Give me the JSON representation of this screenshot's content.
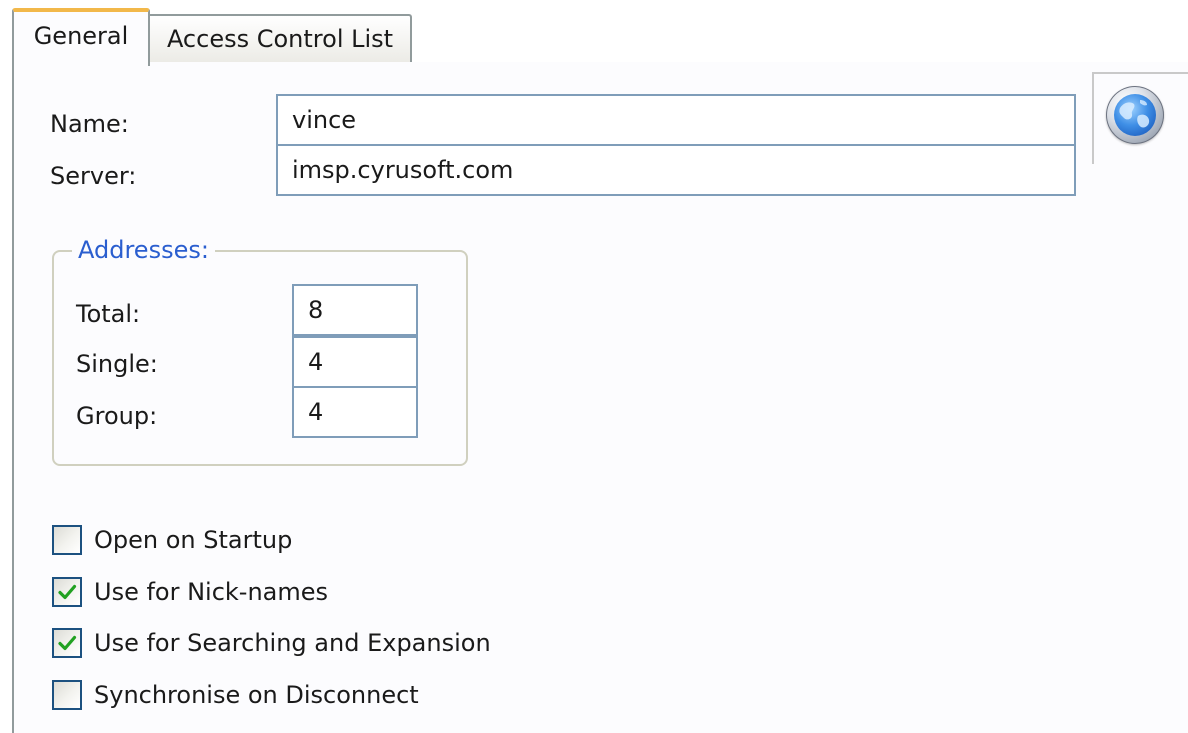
{
  "tabs": {
    "general": "General",
    "acl": "Access Control List"
  },
  "fields": {
    "name_label": "Name:",
    "name_value": "vince",
    "server_label": "Server:",
    "server_value": "imsp.cyrusoft.com"
  },
  "addresses": {
    "legend": "Addresses:",
    "total_label": "Total:",
    "total_value": "8",
    "single_label": "Single:",
    "single_value": "4",
    "group_label": "Group:",
    "group_value": "4"
  },
  "options": [
    {
      "label": "Open on Startup",
      "checked": false
    },
    {
      "label": "Use for Nick-names",
      "checked": true
    },
    {
      "label": "Use for Searching and Expansion",
      "checked": true
    },
    {
      "label": "Synchronise on Disconnect",
      "checked": false
    }
  ],
  "icon": "globe-icon",
  "colors": {
    "active_tab_accent": "#f2b84a",
    "groupbox_legend": "#2a5ecf",
    "checkmark": "#21a121",
    "textbox_border": "#7f9db9"
  }
}
